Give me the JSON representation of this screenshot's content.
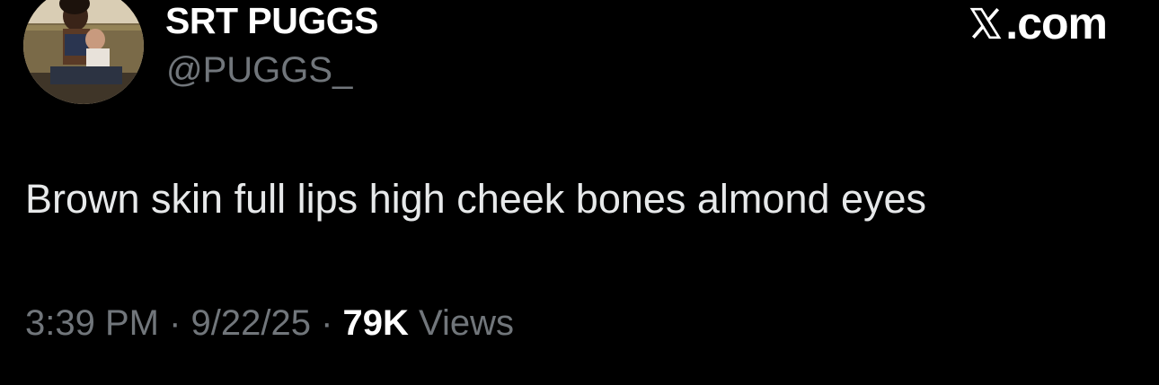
{
  "author": {
    "display_name": "SRT PUGGS",
    "handle": "@PUGGS_"
  },
  "brand": {
    "logo_icon": "x-logo-icon",
    "text": ".com"
  },
  "tweet": {
    "text": "Brown skin full lips high cheek bones almond eyes"
  },
  "meta": {
    "time": "3:39 PM",
    "sep1": " · ",
    "date": "9/22/25",
    "sep2": " · ",
    "views_count": "79K",
    "views_label": " Views"
  },
  "colors": {
    "background": "#000000",
    "primary_text": "#e7e9ea",
    "secondary_text": "#71767b"
  }
}
